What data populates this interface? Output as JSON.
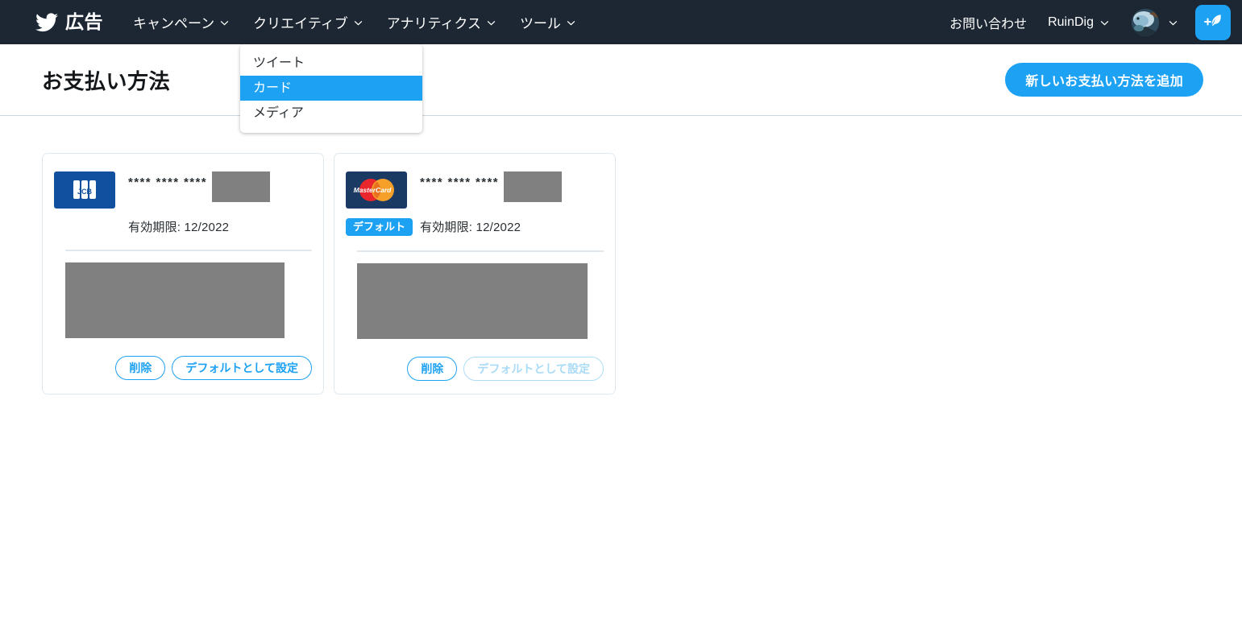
{
  "topbar": {
    "brand": {
      "icon": "twitter-bird-icon",
      "label": "広告"
    },
    "nav": [
      {
        "label": "キャンペーン",
        "caret": "chevron-down-icon",
        "open": false
      },
      {
        "label": "クリエイティブ",
        "caret": "chevron-down-icon",
        "open": true
      },
      {
        "label": "アナリティクス",
        "caret": "chevron-down-icon",
        "open": false
      },
      {
        "label": "ツール",
        "caret": "chevron-down-icon",
        "open": false
      }
    ],
    "contact_label": "お問い合わせ",
    "account_label": "RuinDig",
    "account_caret": "chevron-down-icon",
    "avatar_icon": "user-avatar",
    "avatar_caret": "chevron-down-icon",
    "compose_icon": "compose-tweet-icon",
    "accent_color": "#1da1f2",
    "background_color": "#1c2733"
  },
  "dropdown": {
    "owner": "クリエイティブ",
    "items": [
      {
        "label": "ツイート",
        "active": false
      },
      {
        "label": "カード",
        "active": true
      },
      {
        "label": "メディア",
        "active": false
      }
    ],
    "highlight_color": "#1da1f2"
  },
  "page_header": {
    "title": "お支払い方法",
    "add_button": "新しいお支払い方法を追加"
  },
  "cards": [
    {
      "brand": "JCB",
      "brand_logo_icon": "jcb-logo-icon",
      "brand_colors": {
        "bg": "#10509e",
        "text": "#ffffff"
      },
      "masked_number": "**** **** ****",
      "last4_redacted": true,
      "expiry_label": "有効期限:",
      "expiry_value": "12/2022",
      "is_default": false,
      "default_badge": null,
      "detail_redacted": true,
      "actions": [
        {
          "label": "削除",
          "name": "delete-button",
          "disabled": false
        },
        {
          "label": "デフォルトとして設定",
          "name": "set-default-button",
          "disabled": false
        }
      ]
    },
    {
      "brand": "MasterCard",
      "brand_logo_icon": "mastercard-logo-icon",
      "brand_colors": {
        "bg": "#1b3a63",
        "red": "#e8262b",
        "orange": "#f6a02a"
      },
      "masked_number": "**** **** ****",
      "last4_redacted": true,
      "expiry_label": "有効期限:",
      "expiry_value": "12/2022",
      "is_default": true,
      "default_badge": "デフォルト",
      "detail_redacted": true,
      "actions": [
        {
          "label": "削除",
          "name": "delete-button",
          "disabled": false
        },
        {
          "label": "デフォルトとして設定",
          "name": "set-default-button",
          "disabled": true
        }
      ]
    }
  ]
}
